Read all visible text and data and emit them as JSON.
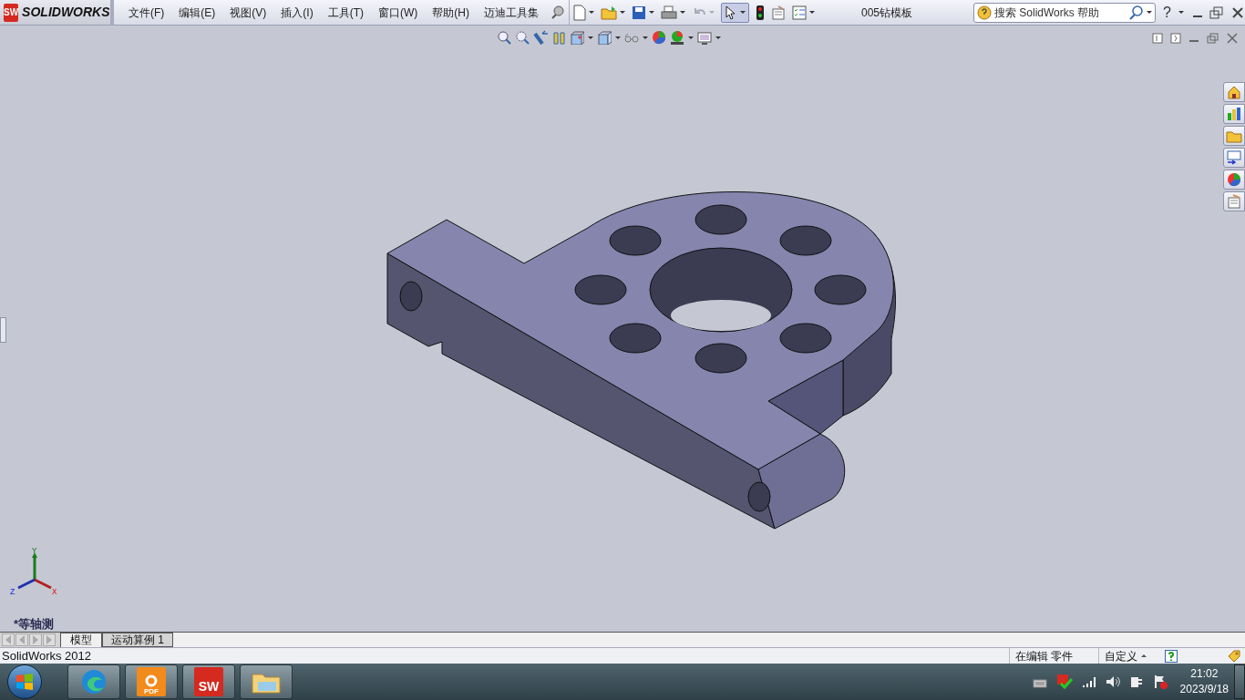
{
  "app": {
    "logo_badge": "SW",
    "logo_text": "SOLIDWORKS"
  },
  "menu": [
    {
      "label": "文件(F)"
    },
    {
      "label": "编辑(E)"
    },
    {
      "label": "视图(V)"
    },
    {
      "label": "插入(I)"
    },
    {
      "label": "工具(T)"
    },
    {
      "label": "窗口(W)"
    },
    {
      "label": "帮助(H)"
    },
    {
      "label": "迈迪工具集"
    }
  ],
  "document_title": "005钻模板",
  "search": {
    "placeholder": "搜索 SolidWorks 帮助"
  },
  "help_button": "?",
  "viewport": {
    "triad": {
      "x": "X",
      "y": "Y",
      "z": "Z"
    },
    "view_label": "*等轴测"
  },
  "tabs": [
    {
      "label": "模型",
      "selected": true
    },
    {
      "label": "运动算例 1",
      "selected": false
    }
  ],
  "status_bar": {
    "app_version": "SolidWorks 2012",
    "mode": "在编辑 零件",
    "units": "自定义"
  },
  "taskbar": {
    "apps": [
      {
        "kind": "edge"
      },
      {
        "kind": "pdf",
        "badge": "PDF"
      },
      {
        "kind": "solidworks",
        "badge": "SW"
      },
      {
        "kind": "folder"
      }
    ],
    "time": "21:02",
    "date": "2023/9/18"
  }
}
